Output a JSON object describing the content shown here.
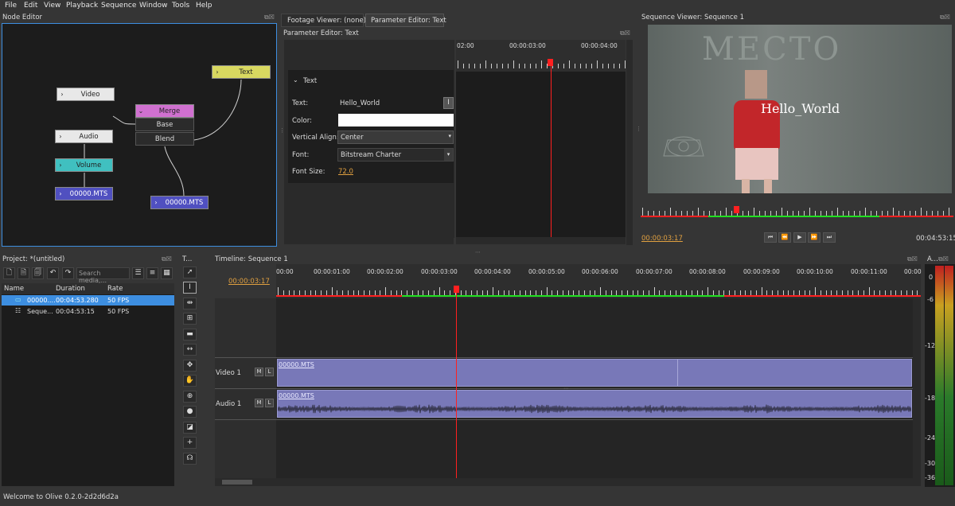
{
  "menu": [
    "File",
    "Edit",
    "View",
    "Playback",
    "Sequence",
    "Window",
    "Tools",
    "Help"
  ],
  "node_editor": {
    "title": "Node Editor",
    "nodes": {
      "text": "Text",
      "video": "Video",
      "merge": "Merge",
      "base": "Base",
      "blend": "Blend",
      "audio": "Audio",
      "volume": "Volume",
      "clip_a": "00000.MTS",
      "clip_b": "00000.MTS"
    }
  },
  "tabs": {
    "footage": "Footage Viewer: (none)",
    "param": "Parameter Editor: Text"
  },
  "param_editor": {
    "title": "Parameter Editor: Text",
    "section": "Text",
    "fields": {
      "text_label": "Text:",
      "text_value": "Hello_World",
      "color_label": "Color:",
      "valign_label": "Vertical Align:",
      "valign_value": "Center",
      "font_label": "Font:",
      "font_value": "Bitstream Charter",
      "size_label": "Font Size:",
      "size_value": "72.0"
    },
    "ruler": [
      "02:00",
      "00:00:03:00",
      "00:00:04:00"
    ]
  },
  "sequence_viewer": {
    "title": "Sequence Viewer: Sequence 1",
    "overlay_text": "Hello_World",
    "chalk_text": "МЕСТО",
    "current_time": "00:00:03:17",
    "end_time": "00:04:53:15"
  },
  "project": {
    "title": "Project: *(untitled)",
    "search_placeholder": "Search media,...",
    "columns": [
      "Name",
      "Duration",
      "Rate"
    ],
    "rows": [
      {
        "name": "00000....",
        "duration": "00:04:53.280",
        "rate": "50 FPS"
      },
      {
        "name": "Seque...",
        "duration": "00:04:53:15",
        "rate": "50 FPS"
      }
    ]
  },
  "tools": {
    "title": "T..."
  },
  "timeline": {
    "title": "Timeline: Sequence 1",
    "current_time": "00:00:03:17",
    "ruler": [
      "00:00",
      "00:00:01:00",
      "00:00:02:00",
      "00:00:03:00",
      "00:00:04:00",
      "00:00:05:00",
      "00:00:06:00",
      "00:00:07:00",
      "00:00:08:00",
      "00:00:09:00",
      "00:00:10:00",
      "00:00:11:00",
      "00:00"
    ],
    "tracks": [
      {
        "name": "Video 1",
        "clip": "00000.MTS",
        "m": "M",
        "l": "L"
      },
      {
        "name": "Audio 1",
        "clip": "00000.MTS",
        "m": "M",
        "l": "L"
      }
    ]
  },
  "audio_meter": {
    "title": "A...",
    "labels": [
      "0",
      "-6",
      "-12",
      "-18",
      "-24",
      "-30",
      "-36"
    ]
  },
  "status": "Welcome to Olive 0.2.0-2d2d6d2a",
  "colors": {
    "accent_blue": "#3d8ee0",
    "playhead": "#ff2020",
    "clip": "#7878b8",
    "node_text": "#d8d860",
    "node_merge": "#d070d0",
    "node_volume": "#40c0c0",
    "node_clip": "#5050c0",
    "link_time": "#e0a040"
  }
}
